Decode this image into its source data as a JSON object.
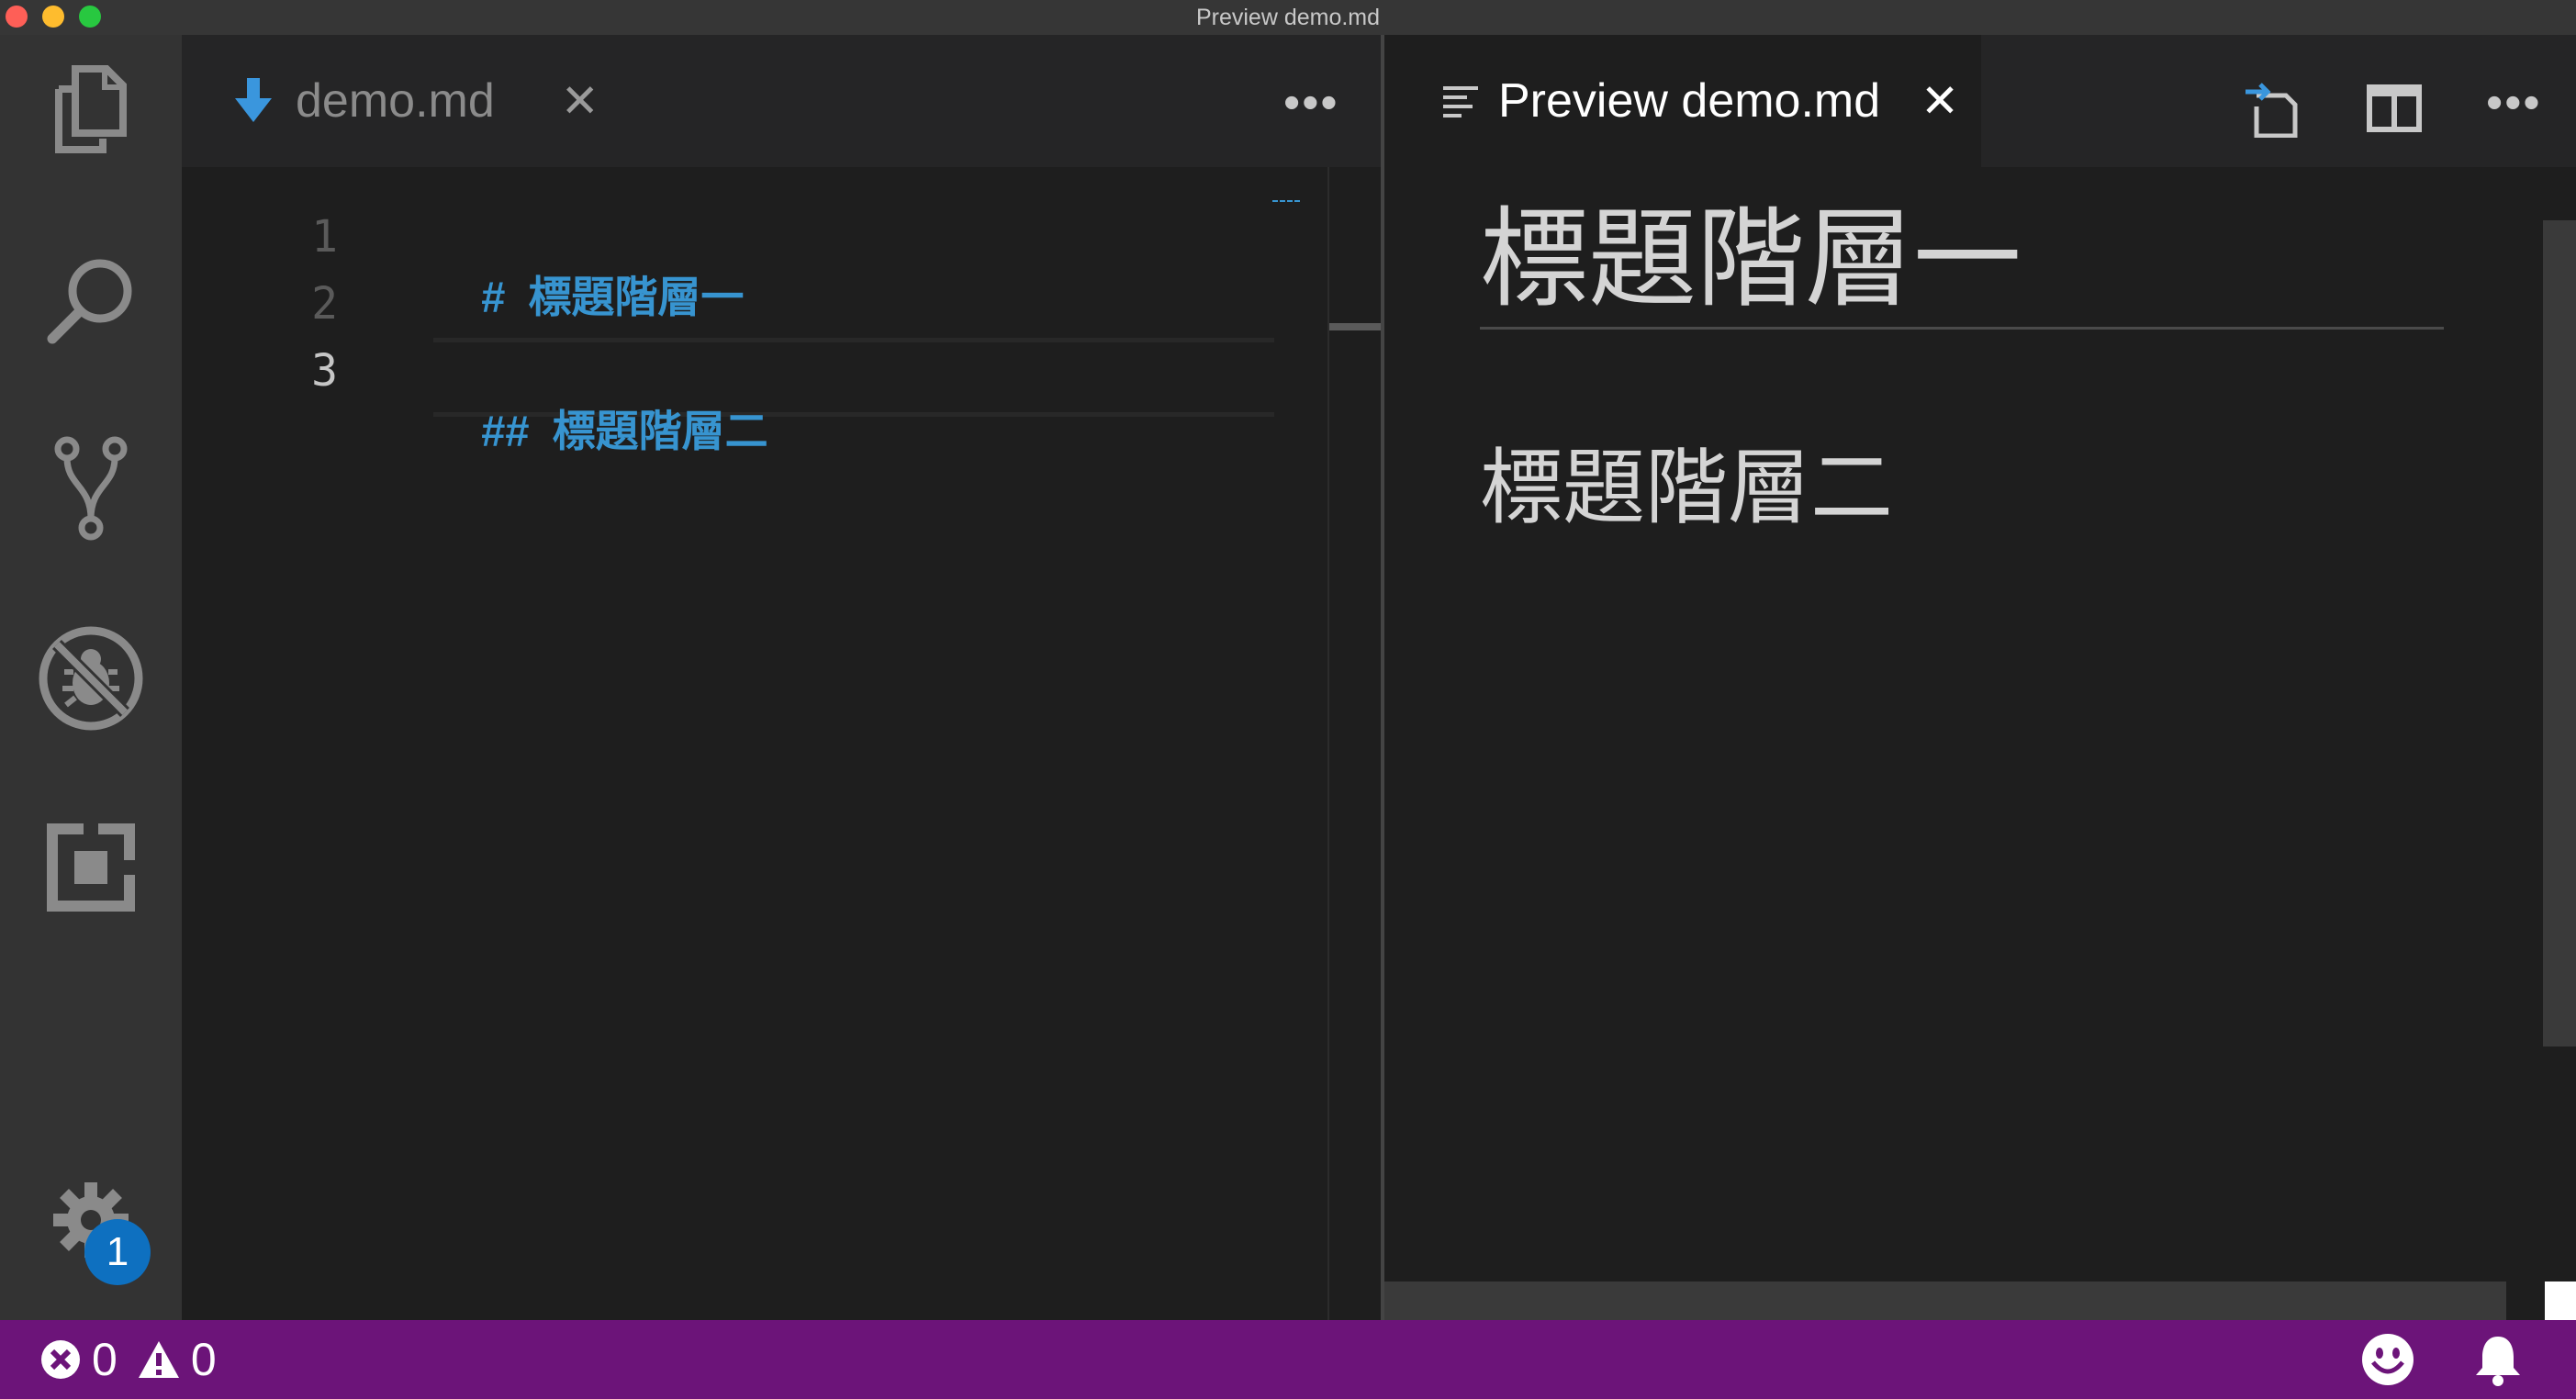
{
  "window": {
    "title": "Preview demo.md"
  },
  "editor": {
    "tab_label": "demo.md",
    "tab_close": "✕",
    "more": "•••",
    "lines": [
      {
        "number": "1",
        "marker": "#",
        "text": "標題階層一"
      },
      {
        "number": "2",
        "marker": "",
        "text": ""
      },
      {
        "number": "3",
        "marker": "##",
        "text": "標題階層二"
      }
    ]
  },
  "preview": {
    "tab_label": "Preview demo.md",
    "tab_close": "✕",
    "more": "•••",
    "h1": "標題階層一",
    "h2": "標題階層二"
  },
  "activity": {
    "icons": [
      "files-icon",
      "search-icon",
      "source-control-icon",
      "debug-icon",
      "extensions-icon"
    ],
    "settings_badge": "1"
  },
  "status": {
    "errors": "0",
    "warnings": "0"
  },
  "colors": {
    "statusbar": "#6c1479",
    "accent": "#0e70c0",
    "heading_blue": "#3794d0"
  }
}
